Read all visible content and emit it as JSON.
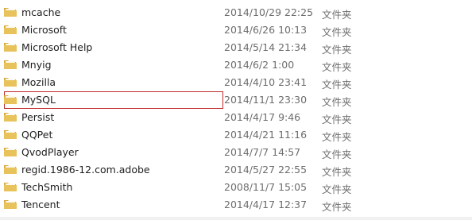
{
  "icon": "folder-icon",
  "colors": {
    "folder": "#e8c25a",
    "highlight_border": "#c02a2a",
    "name_text": "#1e1e1e",
    "meta_text": "#6d6d6d"
  },
  "files": [
    {
      "name": "mcache",
      "date": "2014/10/29 22:25",
      "type": "文件夹"
    },
    {
      "name": "Microsoft",
      "date": "2014/6/26 10:13",
      "type": "文件夹"
    },
    {
      "name": "Microsoft Help",
      "date": "2014/5/14 21:34",
      "type": "文件夹"
    },
    {
      "name": "Mnyig",
      "date": "2014/6/2 1:00",
      "type": "文件夹"
    },
    {
      "name": "Mozilla",
      "date": "2014/4/10 23:41",
      "type": "文件夹"
    },
    {
      "name": "MySQL",
      "date": "2014/11/1 23:30",
      "type": "文件夹"
    },
    {
      "name": "Persist",
      "date": "2014/4/17 9:46",
      "type": "文件夹"
    },
    {
      "name": "QQPet",
      "date": "2014/4/21 11:16",
      "type": "文件夹"
    },
    {
      "name": "QvodPlayer",
      "date": "2014/7/7 14:57",
      "type": "文件夹"
    },
    {
      "name": "regid.1986-12.com.adobe",
      "date": "2014/5/27 22:55",
      "type": "文件夹"
    },
    {
      "name": "TechSmith",
      "date": "2008/11/7 15:05",
      "type": "文件夹"
    },
    {
      "name": "Tencent",
      "date": "2014/4/17 12:37",
      "type": "文件夹"
    }
  ]
}
